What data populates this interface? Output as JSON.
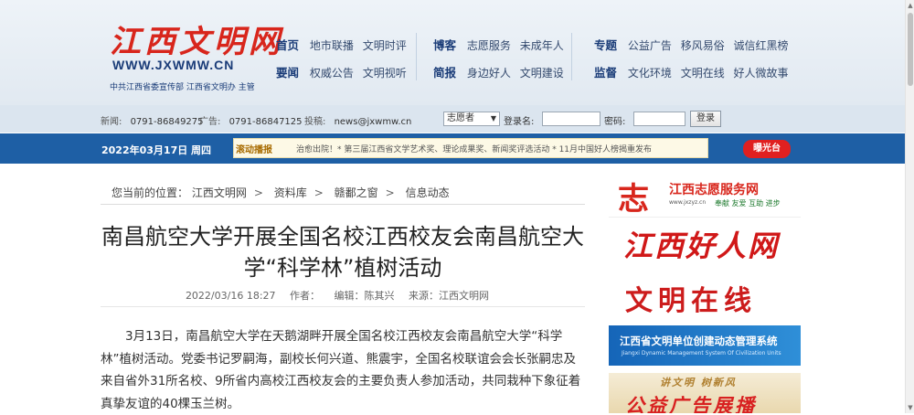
{
  "header": {
    "logo_text": "江西文明网",
    "logo_url": "WWW.JXWMW.CN",
    "logo_sub": "中共江西省委宣传部  江西省文明办  主管",
    "nav_groups": [
      {
        "rows": [
          {
            "head": "首页",
            "links": [
              "地市联播",
              "文明时评"
            ]
          },
          {
            "head": "要闻",
            "links": [
              "权威公告",
              "文明视听"
            ]
          }
        ]
      },
      {
        "rows": [
          {
            "head": "博客",
            "links": [
              "志愿服务",
              "未成年人"
            ]
          },
          {
            "head": "简报",
            "links": [
              "身边好人",
              "文明建设"
            ]
          }
        ]
      },
      {
        "rows": [
          {
            "head": "专题",
            "links": [
              "公益广告",
              "移风易俗",
              "诚信红黑榜"
            ]
          },
          {
            "head": "监督",
            "links": [
              "文化环境",
              "文明在线",
              "好人微故事"
            ]
          }
        ]
      }
    ]
  },
  "infobar": {
    "news_label": "新闻:",
    "news_phone": "0791-86849275",
    "ad_label": "广告:",
    "ad_phone": "0791-86847125",
    "submit_label": "投稿:",
    "submit_email": "news@jxwmw.cn",
    "select_value": "志愿者",
    "username_label": "登录名:",
    "password_label": "密码:",
    "login_button": "登录"
  },
  "bluebar": {
    "date": "2022年03月17日 周四",
    "scroll_tag": "滚动播报",
    "scroll_text": "治愈出院！* 第三届江西省文学艺术奖、理论成果奖、新闻奖评选活动 * 11月中国好人榜揭重发布",
    "expose_button": "曝光台"
  },
  "breadcrumb": {
    "prefix": "您当前的位置：",
    "items": [
      "江西文明网",
      "资料库",
      "赣鄱之窗",
      "信息动态"
    ]
  },
  "article": {
    "title": "南昌航空大学开展全国名校江西校友会南昌航空大学“科学林”植树活动",
    "datetime": "2022/03/16 18:27",
    "author_label": "作者：",
    "editor": "编辑：陈其兴",
    "source": "来源：江西文明网",
    "body": "3月13日，南昌航空大学在天鹅湖畔开展全国名校江西校友会南昌航空大学“科学林”植树活动。党委书记罗嗣海，副校长何兴道、熊震宇，全国名校联谊会会长张嗣忠及来自省外31所名校、9所省内高校江西校友会的主要负责人参加活动，共同栽种下象征着真挚友谊的40棵玉兰树。"
  },
  "sidebar": {
    "banner1": {
      "glyph": "志",
      "title": "江西志愿服务网",
      "url": "www.jxzyz.cn",
      "slogan": "奉献 友爱 互助 进步"
    },
    "banner2": {
      "title": "江西好人网"
    },
    "banner3": {
      "title": "文明在线"
    },
    "banner4": {
      "title": "江西省文明单位创建动态管理系统",
      "subtitle": "Jiangxi Dynamic Management System Of Civilization Units"
    },
    "banner5": {
      "slogan": "讲文明 树新风",
      "title": "公益广告展播"
    }
  },
  "colors": {
    "brand_red": "#d8261c",
    "nav_blue": "#1e5fa5",
    "header_bg": "#e6edf4"
  }
}
